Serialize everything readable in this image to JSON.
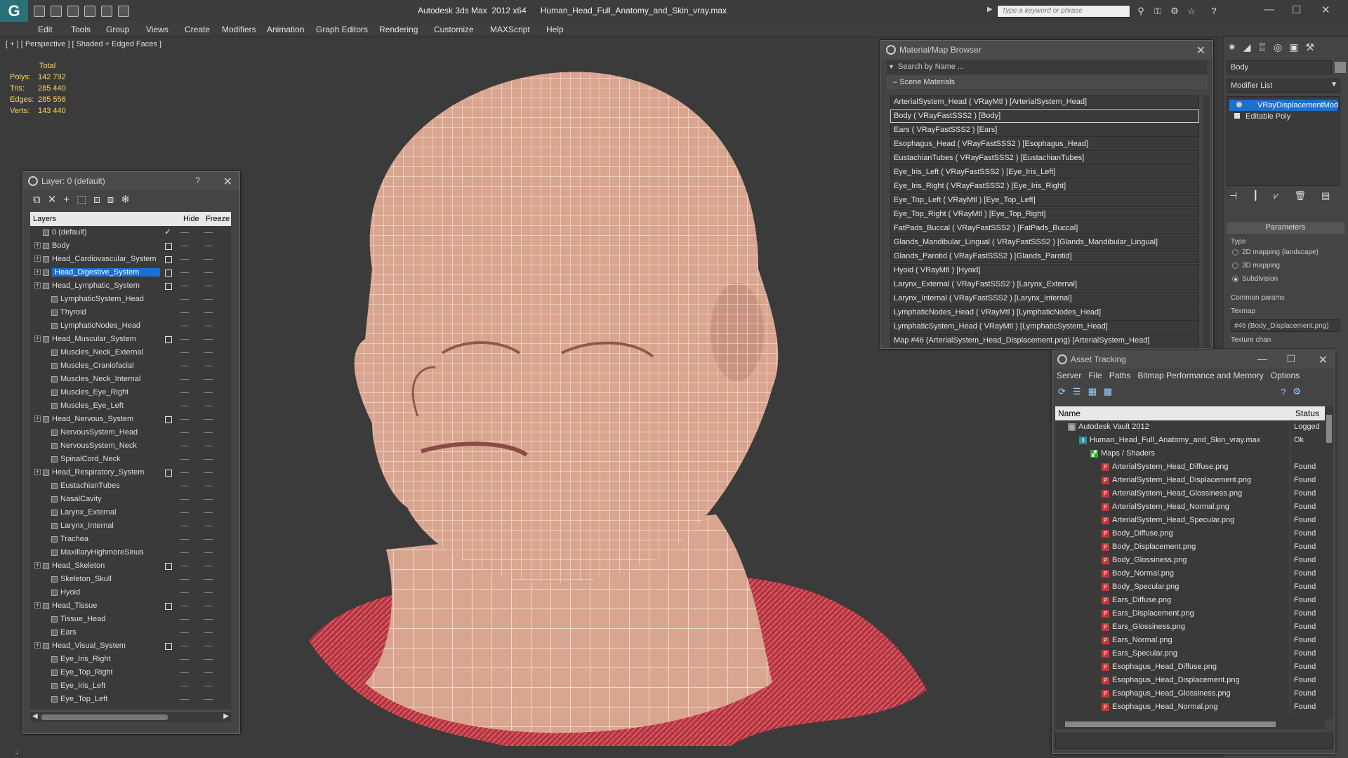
{
  "app": {
    "title": "Autodesk 3ds Max  2012 x64      Human_Head_Full_Anatomy_and_Skin_vray.max",
    "search_placeholder": "Type a keyword or phrase"
  },
  "menu": [
    "Edit",
    "Tools",
    "Group",
    "Views",
    "Create",
    "Modifiers",
    "Animation",
    "Graph Editors",
    "Rendering",
    "Customize",
    "MAXScript",
    "Help"
  ],
  "viewport": {
    "label": "[ + ] [ Perspective ] [ Shaded + Edged Faces ]",
    "stats": {
      "total_label": "Total",
      "rows": [
        {
          "label": "Polys:",
          "value": "142 792"
        },
        {
          "label": "Tris:",
          "value": "285 440"
        },
        {
          "label": "Edges:",
          "value": "285 556"
        },
        {
          "label": "Verts:",
          "value": "143 440"
        }
      ]
    }
  },
  "layers": {
    "title": "Layer: 0 (default)",
    "help": "?",
    "col_layers": "Layers",
    "col_hide": "Hide",
    "col_freeze": "Freeze",
    "items": [
      {
        "name": "0 (default)",
        "level": 0,
        "check": true
      },
      {
        "name": "Body",
        "level": 0,
        "box": true,
        "expand": true
      },
      {
        "name": "Head_Cardiovascular_System",
        "level": 0,
        "box": true,
        "expand": true
      },
      {
        "name": "Head_Digestive_System",
        "level": 0,
        "box": true,
        "expand": true,
        "selected": true
      },
      {
        "name": "Head_Lymphatic_System",
        "level": 0,
        "box": true,
        "expand": true
      },
      {
        "name": "LymphaticSystem_Head",
        "level": 1
      },
      {
        "name": "Thyroid",
        "level": 1
      },
      {
        "name": "LymphaticNodes_Head",
        "level": 1
      },
      {
        "name": "Head_Muscular_System",
        "level": 0,
        "box": true,
        "expand": true
      },
      {
        "name": "Muscles_Neck_External",
        "level": 1
      },
      {
        "name": "Muscles_Craniofacial",
        "level": 1
      },
      {
        "name": "Muscles_Neck_Internal",
        "level": 1
      },
      {
        "name": "Muscles_Eye_Right",
        "level": 1
      },
      {
        "name": "Muscles_Eye_Left",
        "level": 1
      },
      {
        "name": "Head_Nervous_System",
        "level": 0,
        "box": true,
        "expand": true
      },
      {
        "name": "NervousSystem_Head",
        "level": 1
      },
      {
        "name": "NervousSystem_Neck",
        "level": 1
      },
      {
        "name": "SpinalCord_Neck",
        "level": 1
      },
      {
        "name": "Head_Respiratory_System",
        "level": 0,
        "box": true,
        "expand": true
      },
      {
        "name": "EustachianTubes",
        "level": 1
      },
      {
        "name": "NasalCavity",
        "level": 1
      },
      {
        "name": "Larynx_External",
        "level": 1
      },
      {
        "name": "Larynx_Internal",
        "level": 1
      },
      {
        "name": "Trachea",
        "level": 1
      },
      {
        "name": "MaxillaryHighmoreSinus",
        "level": 1
      },
      {
        "name": "Head_Skeleton",
        "level": 0,
        "box": true,
        "expand": true
      },
      {
        "name": "Skeleton_Skull",
        "level": 1
      },
      {
        "name": "Hyoid",
        "level": 1
      },
      {
        "name": "Head_Tissue",
        "level": 0,
        "box": true,
        "expand": true
      },
      {
        "name": "Tissue_Head",
        "level": 1
      },
      {
        "name": "Ears",
        "level": 1
      },
      {
        "name": "Head_Visual_System",
        "level": 0,
        "box": true,
        "expand": true
      },
      {
        "name": "Eye_Iris_Right",
        "level": 1
      },
      {
        "name": "Eye_Top_Right",
        "level": 1
      },
      {
        "name": "Eye_Iris_Left",
        "level": 1
      },
      {
        "name": "Eye_Top_Left",
        "level": 1
      }
    ]
  },
  "material_browser": {
    "title": "Material/Map Browser",
    "search_placeholder": "Search by Name ...",
    "group": "Scene Materials",
    "items": [
      "ArterialSystem_Head  ( VRayMtl )  [ArterialSystem_Head]",
      "Body  ( VRayFastSSS2 )  [Body]",
      "Ears  ( VRayFastSSS2 )  [Ears]",
      "Esophagus_Head  ( VRayFastSSS2 )  [Esophagus_Head]",
      "EustachianTubes  ( VRayFastSSS2 )  [EustachianTubes]",
      "Eye_Iris_Left  ( VRayFastSSS2 )  [Eye_Iris_Left]",
      "Eye_Iris_Right  ( VRayFastSSS2 )  [Eye_Iris_Right]",
      "Eye_Top_Left  ( VRayMtl )  [Eye_Top_Left]",
      "Eye_Top_Right  ( VRayMtl )  [Eye_Top_Right]",
      "FatPads_Buccal  ( VRayFastSSS2 )  [FatPads_Buccal]",
      "Glands_Mandibular_Lingual  ( VRayFastSSS2 )  [Glands_Mandibular_Lingual]",
      "Glands_Parotid  ( VRayFastSSS2 )  [Glands_Parotid]",
      "Hyoid  ( VRayMtl )  [Hyoid]",
      "Larynx_External  ( VRayFastSSS2 )  [Larynx_External]",
      "Larynx_Internal  ( VRayFastSSS2 )  [Larynx_Internal]",
      "LymphaticNodes_Head  ( VRayMtl )  [LymphaticNodes_Head]",
      "LymphaticSystem_Head  ( VRayMtl )  [LymphaticSystem_Head]",
      "Map #46 (ArterialSystem_Head_Displacement.png)  [ArterialSystem_Head]"
    ],
    "selected_index": 1
  },
  "command_panel": {
    "object_name": "Body",
    "modifier_list": "Modifier List",
    "stack": [
      "VRayDisplacementMod",
      "Editable Poly"
    ],
    "params_title": "Parameters",
    "type_label": "Type",
    "types": [
      "2D mapping (landscape)",
      "3D mapping",
      "Subdivision"
    ],
    "type_selected": 2,
    "common_label": "Common params",
    "texmap_label": "Texmap",
    "texmap_value": "#46 (Body_Displacement.png)",
    "texture_chan": "Texture chan"
  },
  "asset_tracking": {
    "title": "Asset Tracking",
    "menu": [
      "Server",
      "File",
      "Paths",
      "Bitmap Performance and Memory",
      "Options"
    ],
    "col_name": "Name",
    "col_status": "Status",
    "rows": [
      {
        "name": "Autodesk Vault 2012",
        "status": "Logged",
        "level": 0,
        "icon": "vault"
      },
      {
        "name": "Human_Head_Full_Anatomy_and_Skin_vray.max",
        "status": "Ok",
        "level": 1,
        "icon": "max"
      },
      {
        "name": "Maps / Shaders",
        "status": "",
        "level": 2,
        "icon": "maps"
      },
      {
        "name": "ArterialSystem_Head_Diffuse.png",
        "status": "Found",
        "level": 3,
        "icon": "png"
      },
      {
        "name": "ArterialSystem_Head_Displacement.png",
        "status": "Found",
        "level": 3,
        "icon": "png"
      },
      {
        "name": "ArterialSystem_Head_Glossiness.png",
        "status": "Found",
        "level": 3,
        "icon": "png"
      },
      {
        "name": "ArterialSystem_Head_Normal.png",
        "status": "Found",
        "level": 3,
        "icon": "png"
      },
      {
        "name": "ArterialSystem_Head_Specular.png",
        "status": "Found",
        "level": 3,
        "icon": "png"
      },
      {
        "name": "Body_Diffuse.png",
        "status": "Found",
        "level": 3,
        "icon": "png"
      },
      {
        "name": "Body_Displacement.png",
        "status": "Found",
        "level": 3,
        "icon": "png"
      },
      {
        "name": "Body_Glossiness.png",
        "status": "Found",
        "level": 3,
        "icon": "png"
      },
      {
        "name": "Body_Normal.png",
        "status": "Found",
        "level": 3,
        "icon": "png"
      },
      {
        "name": "Body_Specular.png",
        "status": "Found",
        "level": 3,
        "icon": "png"
      },
      {
        "name": "Ears_Diffuse.png",
        "status": "Found",
        "level": 3,
        "icon": "png"
      },
      {
        "name": "Ears_Displacement.png",
        "status": "Found",
        "level": 3,
        "icon": "png"
      },
      {
        "name": "Ears_Glossiness.png",
        "status": "Found",
        "level": 3,
        "icon": "png"
      },
      {
        "name": "Ears_Normal.png",
        "status": "Found",
        "level": 3,
        "icon": "png"
      },
      {
        "name": "Ears_Specular.png",
        "status": "Found",
        "level": 3,
        "icon": "png"
      },
      {
        "name": "Esophagus_Head_Diffuse.png",
        "status": "Found",
        "level": 3,
        "icon": "png"
      },
      {
        "name": "Esophagus_Head_Displacement.png",
        "status": "Found",
        "level": 3,
        "icon": "png"
      },
      {
        "name": "Esophagus_Head_Glossiness.png",
        "status": "Found",
        "level": 3,
        "icon": "png"
      },
      {
        "name": "Esophagus_Head_Normal.png",
        "status": "Found",
        "level": 3,
        "icon": "png"
      }
    ]
  },
  "colors": {
    "selection": "#1a6fd1",
    "stats": "#ffd35c",
    "skin": "#d9a58f",
    "muscle": "#b8333f"
  }
}
